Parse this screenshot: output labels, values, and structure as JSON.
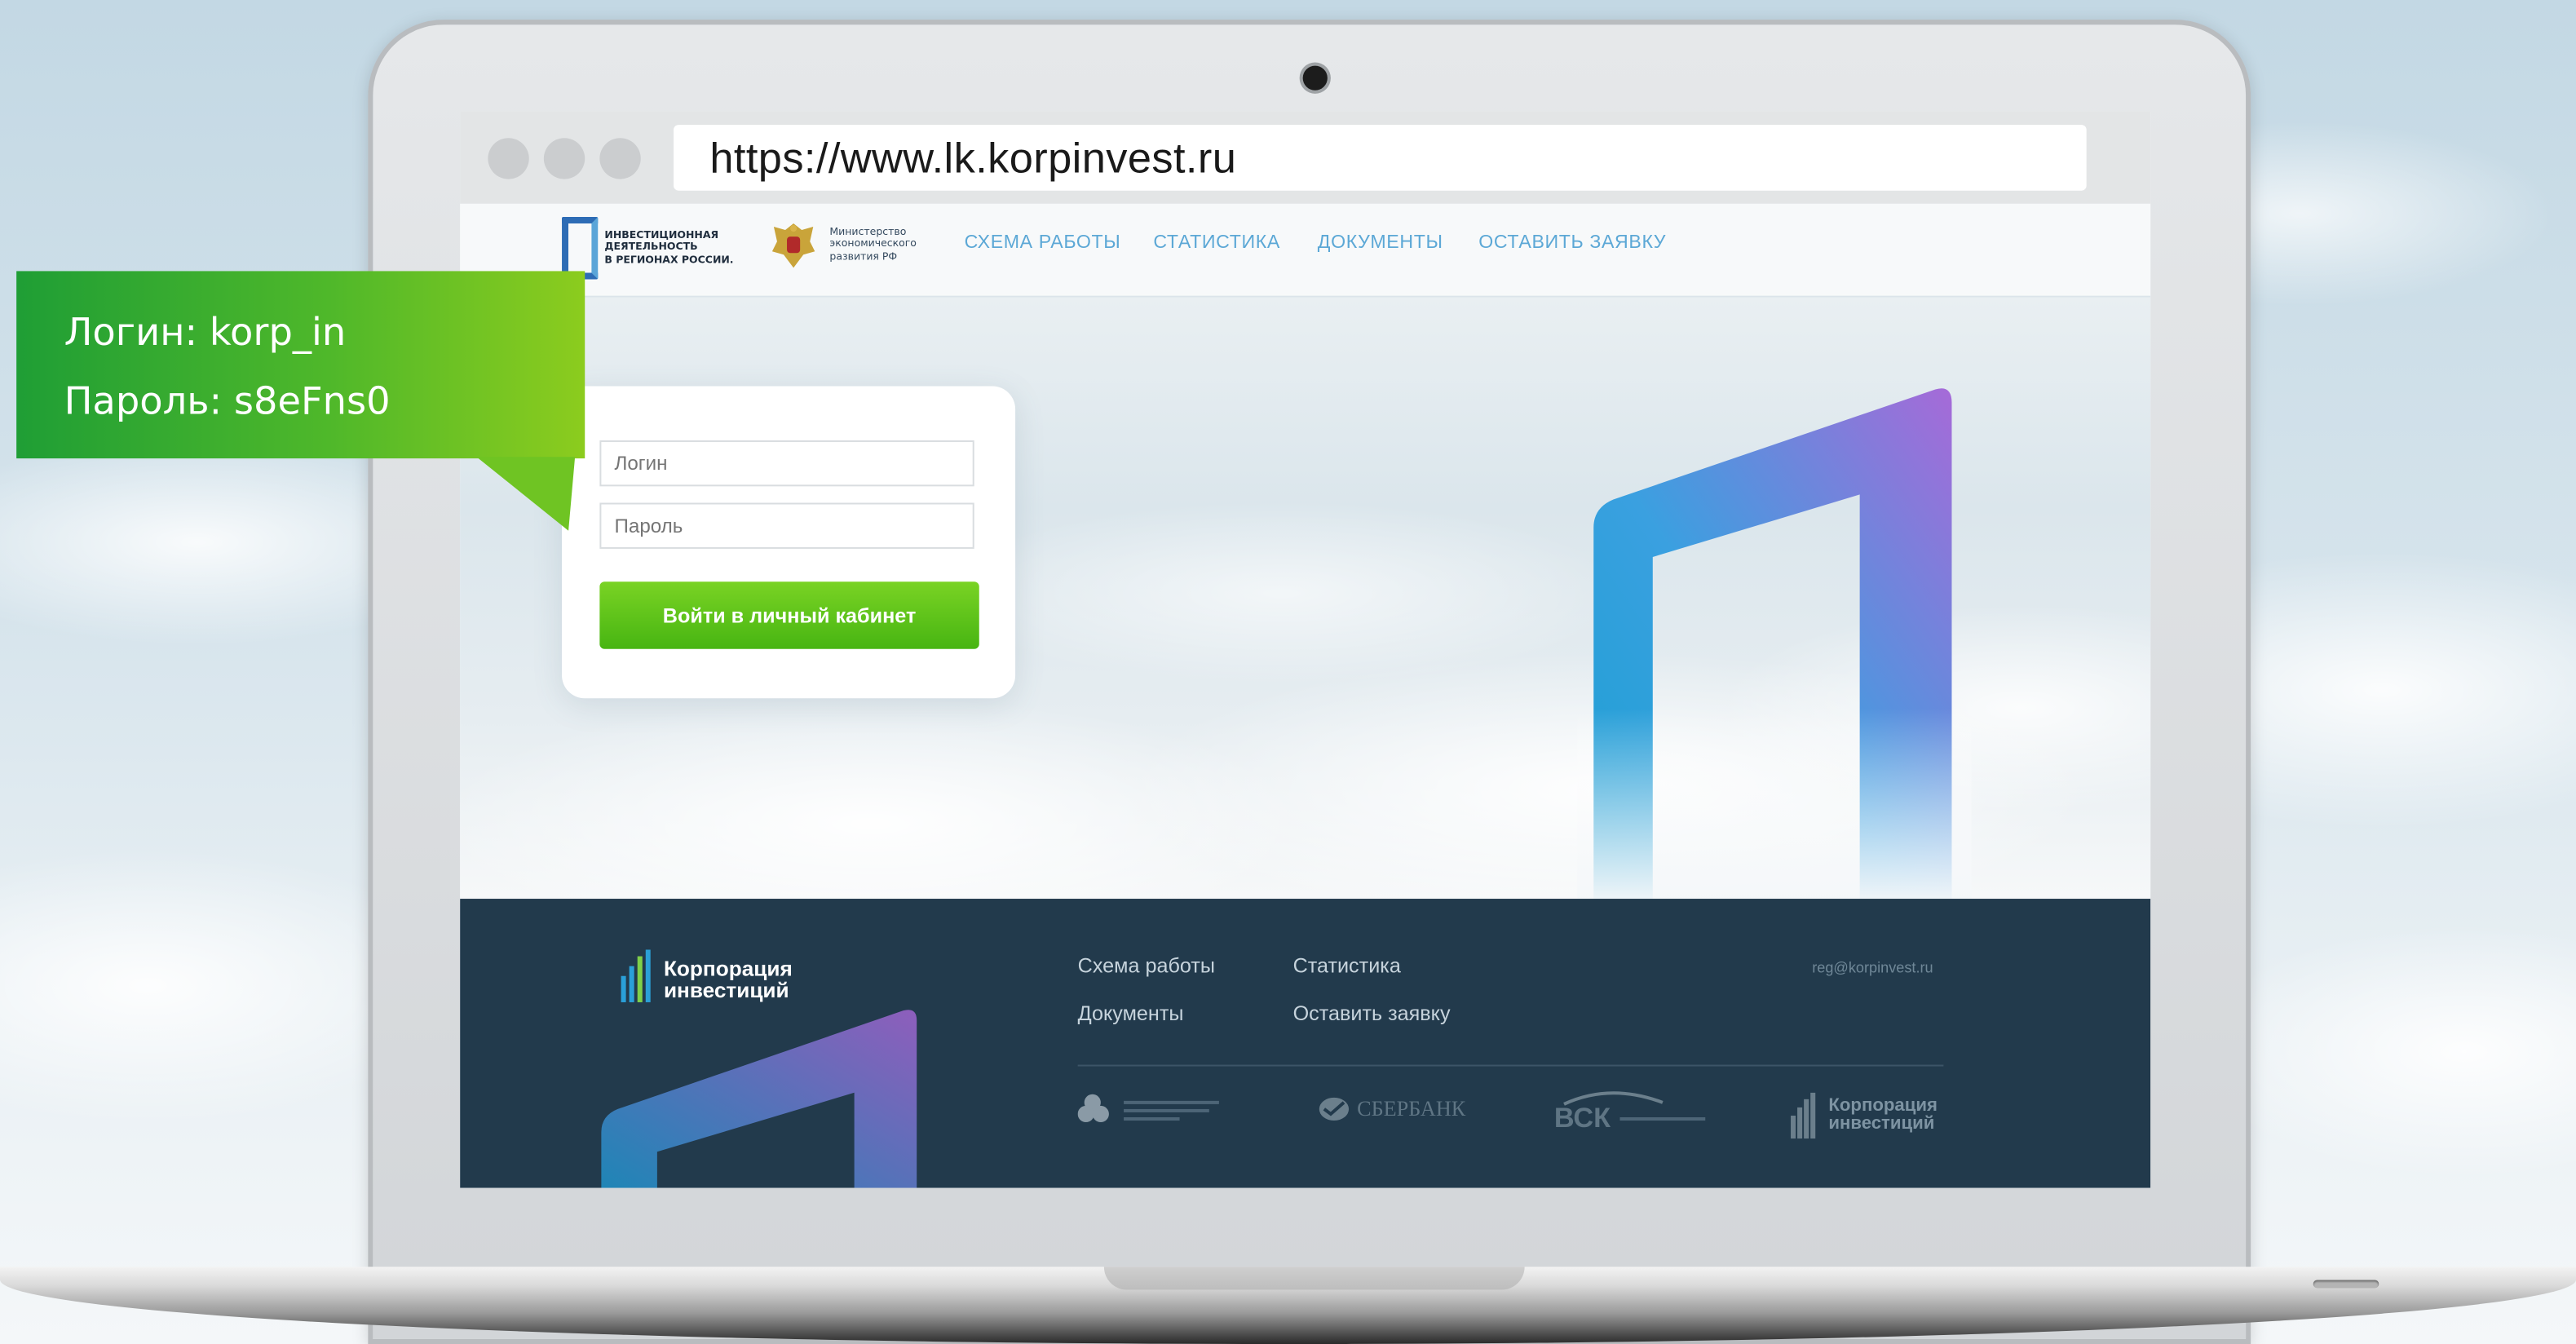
{
  "browser": {
    "url": "https://www.lk.korpinvest.ru"
  },
  "header": {
    "logo_lines": [
      "ИНВЕСТИЦИОННАЯ",
      "ДЕЯТЕЛЬНОСТЬ",
      "В РЕГИОНАХ РОССИИ."
    ],
    "ministry_lines": [
      "Министерство",
      "экономического",
      "развития РФ"
    ],
    "nav": [
      "СХЕМА РАБОТЫ",
      "СТАТИСТИКА",
      "ДОКУМЕНТЫ",
      "ОСТАВИТЬ ЗАЯВКУ"
    ]
  },
  "login": {
    "login_placeholder": "Логин",
    "password_placeholder": "Пароль",
    "submit_label": "Войти в личный кабинет"
  },
  "footer": {
    "brand_lines": [
      "Корпорация",
      "инвестиций"
    ],
    "links": [
      "Схема работы",
      "Статистика",
      "Документы",
      "Оставить заявку"
    ],
    "email": "reg@korpinvest.ru",
    "partners": {
      "sberbank": "СБЕРБАНК",
      "vsk": "ВСК",
      "corp_lines": [
        "Корпорация",
        "инвестиций"
      ]
    }
  },
  "callout": {
    "login_line": "Логин: korp_in",
    "password_line": "Пароль: s8eFns0"
  },
  "colors": {
    "accent_green": "#47b512",
    "nav_blue": "#5ca8d6",
    "footer_bg": "#223a4c",
    "callout_green": "#4fb82a"
  }
}
